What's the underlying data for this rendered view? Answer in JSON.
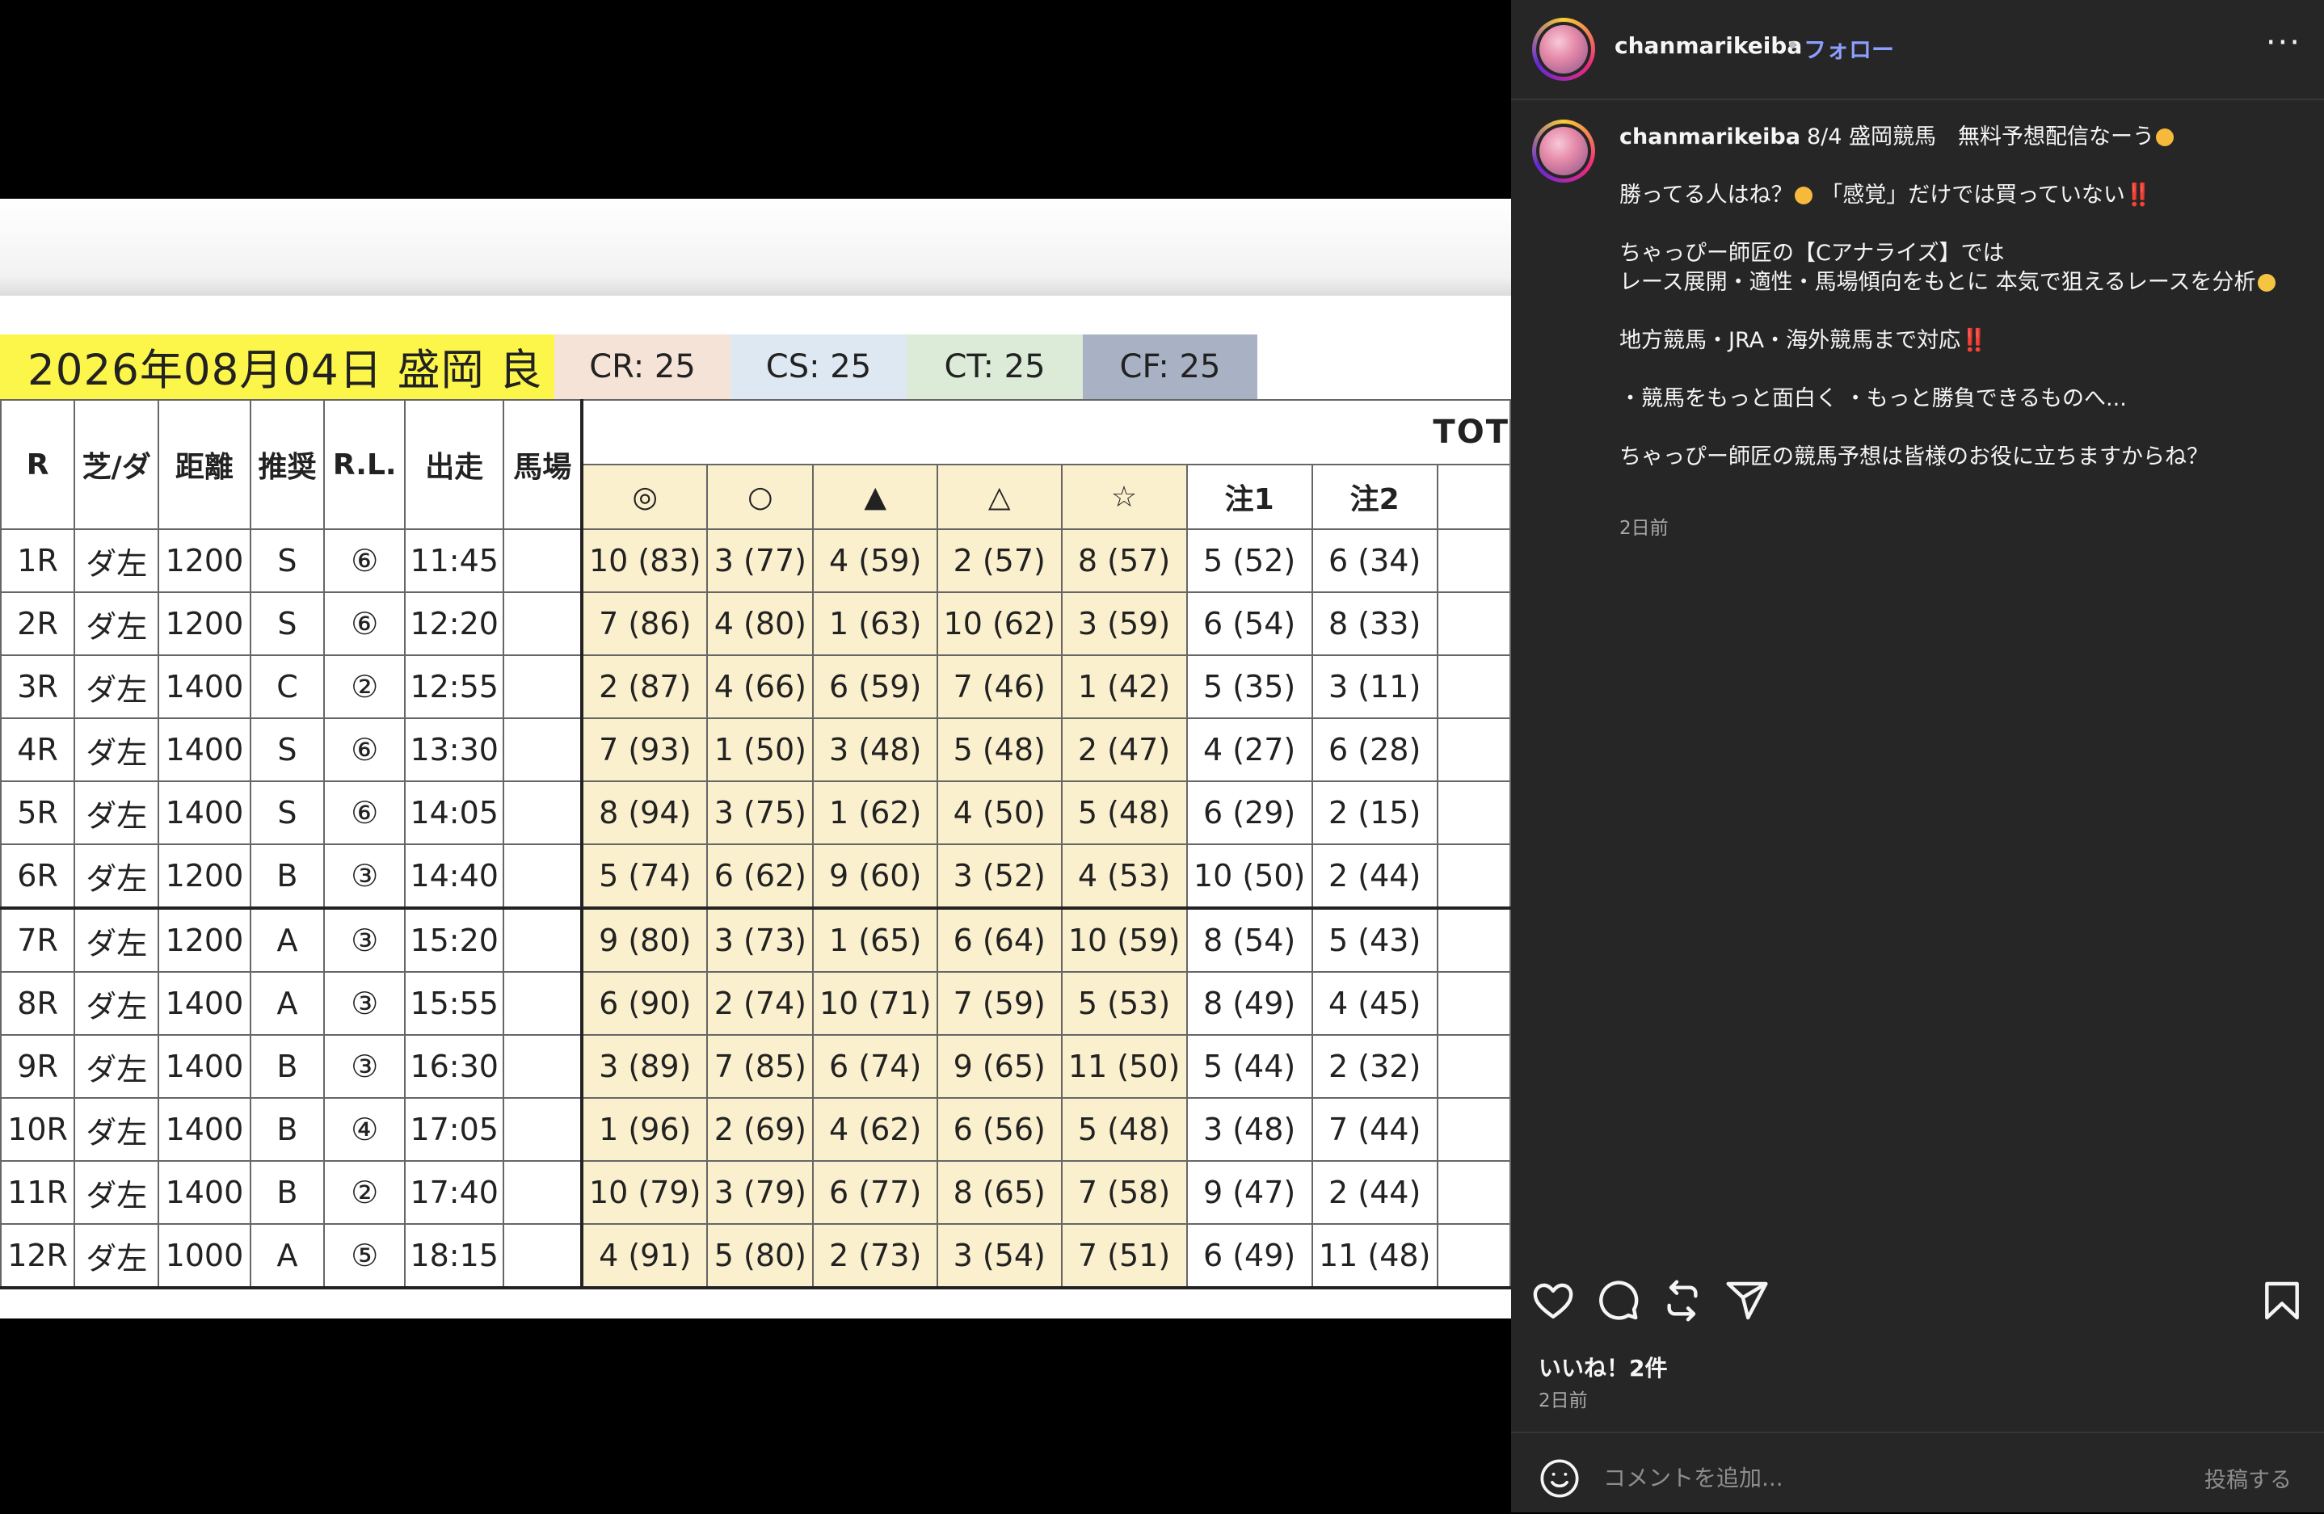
{
  "sheet": {
    "date_title": "2026年08月04日 盛岡 良",
    "cr": "CR: 25",
    "cs": "CS: 25",
    "ct": "CT: 25",
    "cf": "CF: 25",
    "tot": "TOT",
    "headers": [
      "R",
      "芝/ダ",
      "距離",
      "推奨",
      "R.L.",
      "出走",
      "馬場"
    ],
    "sub_headers": [
      "◎",
      "○",
      "▲",
      "△",
      "☆",
      "注1",
      "注2"
    ],
    "rows": [
      [
        "1R",
        "ダ左",
        "1200",
        "S",
        "⑥",
        "11:45",
        "",
        "10 (83)",
        "3 (77)",
        "4 (59)",
        "2 (57)",
        "8 (57)",
        "5 (52)",
        "6 (34)"
      ],
      [
        "2R",
        "ダ左",
        "1200",
        "S",
        "⑥",
        "12:20",
        "",
        "7 (86)",
        "4 (80)",
        "1 (63)",
        "10 (62)",
        "3 (59)",
        "6 (54)",
        "8 (33)"
      ],
      [
        "3R",
        "ダ左",
        "1400",
        "C",
        "②",
        "12:55",
        "",
        "2 (87)",
        "4 (66)",
        "6 (59)",
        "7 (46)",
        "1 (42)",
        "5 (35)",
        "3 (11)"
      ],
      [
        "4R",
        "ダ左",
        "1400",
        "S",
        "⑥",
        "13:30",
        "",
        "7 (93)",
        "1 (50)",
        "3 (48)",
        "5 (48)",
        "2 (47)",
        "4 (27)",
        "6 (28)"
      ],
      [
        "5R",
        "ダ左",
        "1400",
        "S",
        "⑥",
        "14:05",
        "",
        "8 (94)",
        "3 (75)",
        "1 (62)",
        "4 (50)",
        "5 (48)",
        "6 (29)",
        "2 (15)"
      ],
      [
        "6R",
        "ダ左",
        "1200",
        "B",
        "③",
        "14:40",
        "",
        "5 (74)",
        "6 (62)",
        "9 (60)",
        "3 (52)",
        "4 (53)",
        "10 (50)",
        "2 (44)"
      ],
      [
        "7R",
        "ダ左",
        "1200",
        "A",
        "③",
        "15:20",
        "",
        "9 (80)",
        "3 (73)",
        "1 (65)",
        "6 (64)",
        "10 (59)",
        "8 (54)",
        "5 (43)"
      ],
      [
        "8R",
        "ダ左",
        "1400",
        "A",
        "③",
        "15:55",
        "",
        "6 (90)",
        "2 (74)",
        "10 (71)",
        "7 (59)",
        "5 (53)",
        "8 (49)",
        "4 (45)"
      ],
      [
        "9R",
        "ダ左",
        "1400",
        "B",
        "③",
        "16:30",
        "",
        "3 (89)",
        "7 (85)",
        "6 (74)",
        "9 (65)",
        "11 (50)",
        "5 (44)",
        "2 (32)"
      ],
      [
        "10R",
        "ダ左",
        "1400",
        "B",
        "④",
        "17:05",
        "",
        "1 (96)",
        "2 (69)",
        "4 (62)",
        "6 (56)",
        "5 (48)",
        "3 (48)",
        "7 (44)"
      ],
      [
        "11R",
        "ダ左",
        "1400",
        "B",
        "②",
        "17:40",
        "",
        "10 (79)",
        "3 (79)",
        "6 (77)",
        "8 (65)",
        "7 (58)",
        "9 (47)",
        "2 (44)"
      ],
      [
        "12R",
        "ダ左",
        "1000",
        "A",
        "⑤",
        "18:15",
        "",
        "4 (91)",
        "5 (80)",
        "2 (73)",
        "3 (54)",
        "7 (51)",
        "6 (49)",
        "11 (48)"
      ]
    ]
  },
  "post": {
    "username": "chanmarikeiba",
    "dot": "•",
    "follow": "フォロー",
    "more": "···",
    "caption": {
      "l1": "8/4 盛岡競馬　無料予想配信なーう",
      "l2": "勝ってる人はね？",
      "l2b": " 「感覚」だけでは買っていない",
      "l3": "ちゃっぴー師匠の【Cアナライズ】では",
      "l4": " レース展開・適性・馬場傾向をもとに 本気で狙えるレースを分析",
      "l5": "地方競馬・JRA・海外競馬まで対応",
      "l6": "・競馬をもっと面白く ・もっと勝負できるものへ...",
      "l7": "ちゃっぴー師匠の競馬予想は皆様のお役に立ちますからね？",
      "bang": "‼️"
    },
    "caption_time": "2日前",
    "likes": "いいね！2件",
    "post_time": "2日前",
    "comment_placeholder": "コメントを追加...",
    "post_button": "投稿する",
    "icons": [
      "heart-icon",
      "comment-icon",
      "repost-icon",
      "share-icon",
      "bookmark-icon",
      "emoji-icon"
    ]
  },
  "colors": {
    "panel_bg": "#262626",
    "follow": "#8c9ffc",
    "title_yellow": "#fcf64a",
    "pick_cells": "#fbf0cd",
    "cr": "#f6e3d8",
    "cs": "#dde8f3",
    "ct": "#dcebd8",
    "cf": "#a9b2c4"
  }
}
